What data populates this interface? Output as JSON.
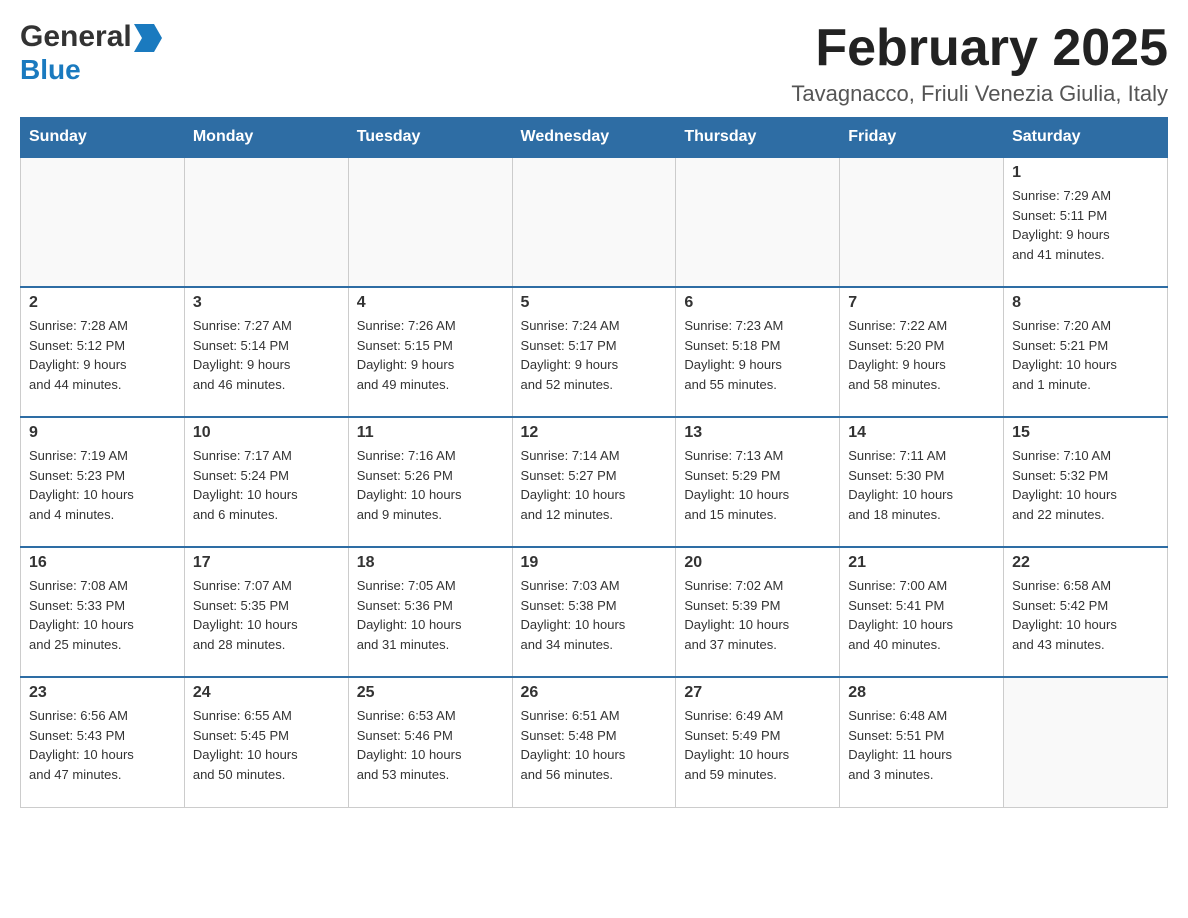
{
  "header": {
    "logo": {
      "general": "General",
      "blue": "Blue"
    },
    "month_title": "February 2025",
    "location": "Tavagnacco, Friuli Venezia Giulia, Italy"
  },
  "days_of_week": [
    "Sunday",
    "Monday",
    "Tuesday",
    "Wednesday",
    "Thursday",
    "Friday",
    "Saturday"
  ],
  "weeks": [
    {
      "days": [
        {
          "number": "",
          "info": ""
        },
        {
          "number": "",
          "info": ""
        },
        {
          "number": "",
          "info": ""
        },
        {
          "number": "",
          "info": ""
        },
        {
          "number": "",
          "info": ""
        },
        {
          "number": "",
          "info": ""
        },
        {
          "number": "1",
          "info": "Sunrise: 7:29 AM\nSunset: 5:11 PM\nDaylight: 9 hours\nand 41 minutes."
        }
      ]
    },
    {
      "days": [
        {
          "number": "2",
          "info": "Sunrise: 7:28 AM\nSunset: 5:12 PM\nDaylight: 9 hours\nand 44 minutes."
        },
        {
          "number": "3",
          "info": "Sunrise: 7:27 AM\nSunset: 5:14 PM\nDaylight: 9 hours\nand 46 minutes."
        },
        {
          "number": "4",
          "info": "Sunrise: 7:26 AM\nSunset: 5:15 PM\nDaylight: 9 hours\nand 49 minutes."
        },
        {
          "number": "5",
          "info": "Sunrise: 7:24 AM\nSunset: 5:17 PM\nDaylight: 9 hours\nand 52 minutes."
        },
        {
          "number": "6",
          "info": "Sunrise: 7:23 AM\nSunset: 5:18 PM\nDaylight: 9 hours\nand 55 minutes."
        },
        {
          "number": "7",
          "info": "Sunrise: 7:22 AM\nSunset: 5:20 PM\nDaylight: 9 hours\nand 58 minutes."
        },
        {
          "number": "8",
          "info": "Sunrise: 7:20 AM\nSunset: 5:21 PM\nDaylight: 10 hours\nand 1 minute."
        }
      ]
    },
    {
      "days": [
        {
          "number": "9",
          "info": "Sunrise: 7:19 AM\nSunset: 5:23 PM\nDaylight: 10 hours\nand 4 minutes."
        },
        {
          "number": "10",
          "info": "Sunrise: 7:17 AM\nSunset: 5:24 PM\nDaylight: 10 hours\nand 6 minutes."
        },
        {
          "number": "11",
          "info": "Sunrise: 7:16 AM\nSunset: 5:26 PM\nDaylight: 10 hours\nand 9 minutes."
        },
        {
          "number": "12",
          "info": "Sunrise: 7:14 AM\nSunset: 5:27 PM\nDaylight: 10 hours\nand 12 minutes."
        },
        {
          "number": "13",
          "info": "Sunrise: 7:13 AM\nSunset: 5:29 PM\nDaylight: 10 hours\nand 15 minutes."
        },
        {
          "number": "14",
          "info": "Sunrise: 7:11 AM\nSunset: 5:30 PM\nDaylight: 10 hours\nand 18 minutes."
        },
        {
          "number": "15",
          "info": "Sunrise: 7:10 AM\nSunset: 5:32 PM\nDaylight: 10 hours\nand 22 minutes."
        }
      ]
    },
    {
      "days": [
        {
          "number": "16",
          "info": "Sunrise: 7:08 AM\nSunset: 5:33 PM\nDaylight: 10 hours\nand 25 minutes."
        },
        {
          "number": "17",
          "info": "Sunrise: 7:07 AM\nSunset: 5:35 PM\nDaylight: 10 hours\nand 28 minutes."
        },
        {
          "number": "18",
          "info": "Sunrise: 7:05 AM\nSunset: 5:36 PM\nDaylight: 10 hours\nand 31 minutes."
        },
        {
          "number": "19",
          "info": "Sunrise: 7:03 AM\nSunset: 5:38 PM\nDaylight: 10 hours\nand 34 minutes."
        },
        {
          "number": "20",
          "info": "Sunrise: 7:02 AM\nSunset: 5:39 PM\nDaylight: 10 hours\nand 37 minutes."
        },
        {
          "number": "21",
          "info": "Sunrise: 7:00 AM\nSunset: 5:41 PM\nDaylight: 10 hours\nand 40 minutes."
        },
        {
          "number": "22",
          "info": "Sunrise: 6:58 AM\nSunset: 5:42 PM\nDaylight: 10 hours\nand 43 minutes."
        }
      ]
    },
    {
      "days": [
        {
          "number": "23",
          "info": "Sunrise: 6:56 AM\nSunset: 5:43 PM\nDaylight: 10 hours\nand 47 minutes."
        },
        {
          "number": "24",
          "info": "Sunrise: 6:55 AM\nSunset: 5:45 PM\nDaylight: 10 hours\nand 50 minutes."
        },
        {
          "number": "25",
          "info": "Sunrise: 6:53 AM\nSunset: 5:46 PM\nDaylight: 10 hours\nand 53 minutes."
        },
        {
          "number": "26",
          "info": "Sunrise: 6:51 AM\nSunset: 5:48 PM\nDaylight: 10 hours\nand 56 minutes."
        },
        {
          "number": "27",
          "info": "Sunrise: 6:49 AM\nSunset: 5:49 PM\nDaylight: 10 hours\nand 59 minutes."
        },
        {
          "number": "28",
          "info": "Sunrise: 6:48 AM\nSunset: 5:51 PM\nDaylight: 11 hours\nand 3 minutes."
        },
        {
          "number": "",
          "info": ""
        }
      ]
    }
  ]
}
